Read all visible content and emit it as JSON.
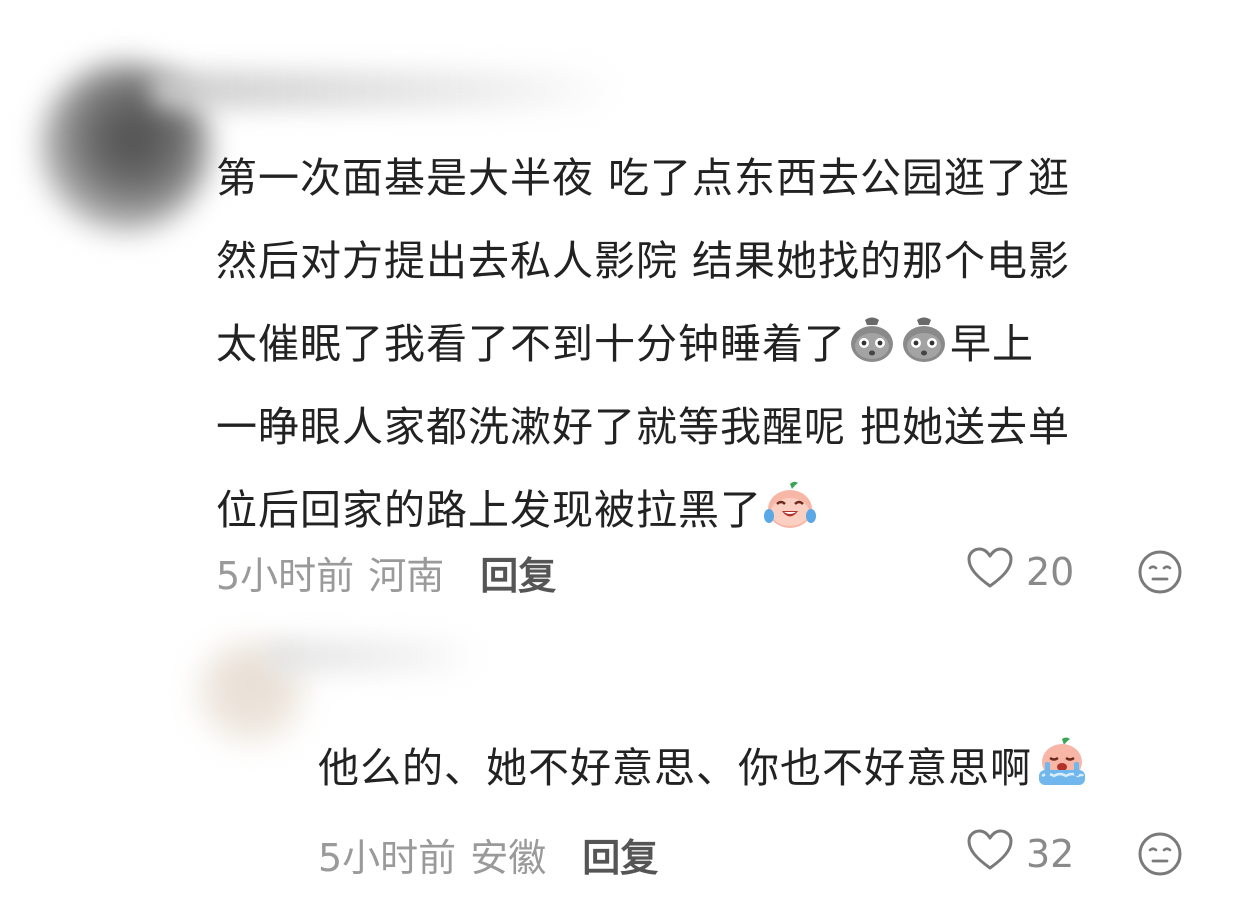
{
  "comments": [
    {
      "lines": [
        "第一次面基是大半夜 吃了点东西去公园逛了逛",
        "然后对方提出去私人影院 结果她找的那个电影",
        "太催眠了我看了不到十分钟睡着了",
        "早上",
        "一睁眼人家都洗漱好了就等我醒呢 把她送去单",
        "位后回家的路上发现被拉黑了"
      ],
      "emojis": [
        "shocked-face-emoji",
        "shocked-face-emoji",
        "laugh-cry-emoji"
      ],
      "time": "5小时前",
      "location": "河南",
      "reply_label": "回复",
      "likes": "20"
    },
    {
      "text": "他么的、她不好意思、你也不好意思啊",
      "emojis": [
        "sobbing-emoji"
      ],
      "time": "5小时前",
      "location": "安徽",
      "reply_label": "回复",
      "likes": "32"
    }
  ],
  "colors": {
    "text": "#222222",
    "meta": "#9a9a9a",
    "reply": "#555555",
    "icon": "#8a8a8a"
  }
}
